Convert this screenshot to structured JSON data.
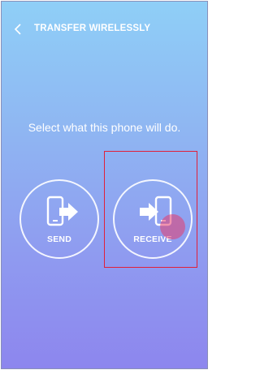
{
  "header": {
    "title": "TRANSFER WIRELESSLY",
    "back_icon": "chevron-left-icon"
  },
  "main": {
    "prompt": "Select what this phone will do.",
    "actions": [
      {
        "label": "SEND",
        "icon": "phone-arrow-out-icon"
      },
      {
        "label": "RECEIVE",
        "icon": "phone-arrow-in-icon"
      }
    ]
  },
  "colors": {
    "gradient_top": "#8fcff7",
    "gradient_bottom": "#8d86ee",
    "highlight": "#e0203a",
    "touch_indicator": "#e63c6e"
  }
}
